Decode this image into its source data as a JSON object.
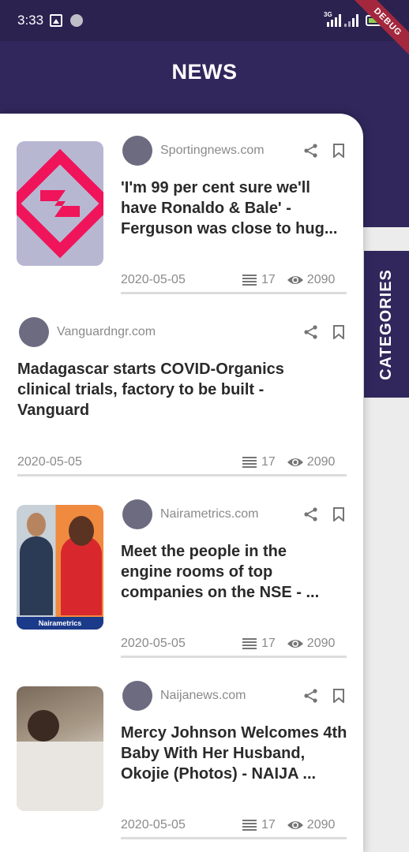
{
  "status_bar": {
    "time": "3:33",
    "network": "3G"
  },
  "debug_banner": "DEBUG",
  "app_bar": {
    "title": "NEWS"
  },
  "categories_tab": {
    "label": "CATEGORIES"
  },
  "articles": [
    {
      "source": "Sportingnews.com",
      "headline": "'I'm 99 per cent sure we'll have Ronaldo & Bale' - Ferguson was close to hug...",
      "date": "2020-05-05",
      "list_count": "17",
      "views": "2090"
    },
    {
      "source": "Vanguardngr.com",
      "headline": "Madagascar starts COVID-Organics clinical trials, factory to be built - Vanguard",
      "date": "2020-05-05",
      "list_count": "17",
      "views": "2090"
    },
    {
      "source": "Nairametrics.com",
      "headline": "Meet the people in the engine rooms of top companies on the NSE - ...",
      "date": "2020-05-05",
      "list_count": "17",
      "views": "2090",
      "thumb_caption": "Nairametrics"
    },
    {
      "source": "Naijanews.com",
      "headline": "Mercy Johnson Welcomes 4th Baby With Her Husband, Okojie (Photos) - NAIJA ...",
      "date": "2020-05-05",
      "list_count": "17",
      "views": "2090"
    }
  ],
  "colors": {
    "primary": "#31275c",
    "status_bar": "#2b2250",
    "accent_logo": "#f0145a"
  }
}
